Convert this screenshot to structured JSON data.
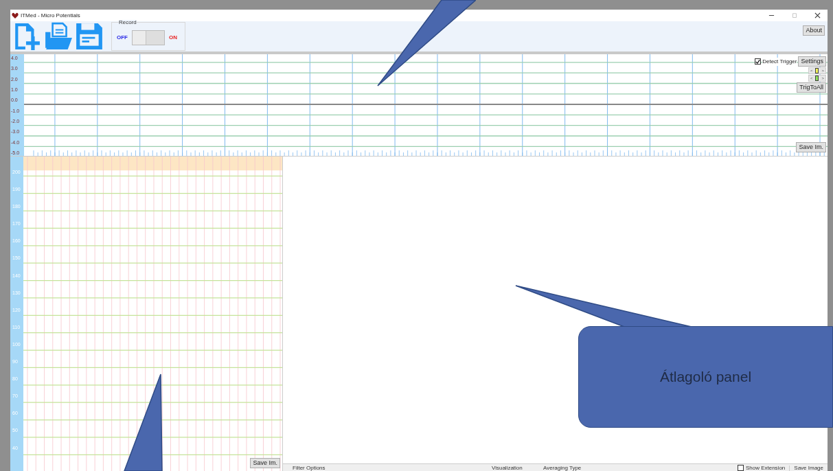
{
  "window": {
    "title": "ITMed - Micro Potentials"
  },
  "record": {
    "label": "Record",
    "off_label": "OFF",
    "on_label": "ON",
    "on": false
  },
  "about_button": "About",
  "trigger_chart": {
    "y_labels": [
      "4.0",
      "3.0",
      "2.0",
      "1.0",
      "0.0",
      "-1.0",
      "-2.0",
      "-3.0",
      "-4.0",
      "-5.0"
    ],
    "detect_trigger": {
      "label": "Detect Trigger",
      "checked": true
    },
    "settings_button": "Settings",
    "trigger_sliders": [
      {
        "left": "<",
        "right": ">",
        "color": "#f2f25a"
      },
      {
        "left": "<",
        "right": ">",
        "color": "#8fe05a"
      }
    ],
    "trig_to_all_button": "TrigToAll",
    "save_button": "Save Im."
  },
  "channel_panel": {
    "y_labels": [
      "200",
      "190",
      "180",
      "170",
      "160",
      "150",
      "140",
      "130",
      "120",
      "110",
      "100",
      "90",
      "80",
      "70",
      "60",
      "50",
      "40"
    ],
    "save_button": "Save Im."
  },
  "averaging_panel": {
    "tabs": [
      "Filter Options",
      "Visualization",
      "Averaging Type"
    ],
    "show_extension": {
      "label": "Show Extension",
      "checked": false
    },
    "save_button": "Save Image"
  },
  "callout": {
    "text": "Átlagoló panel"
  }
}
